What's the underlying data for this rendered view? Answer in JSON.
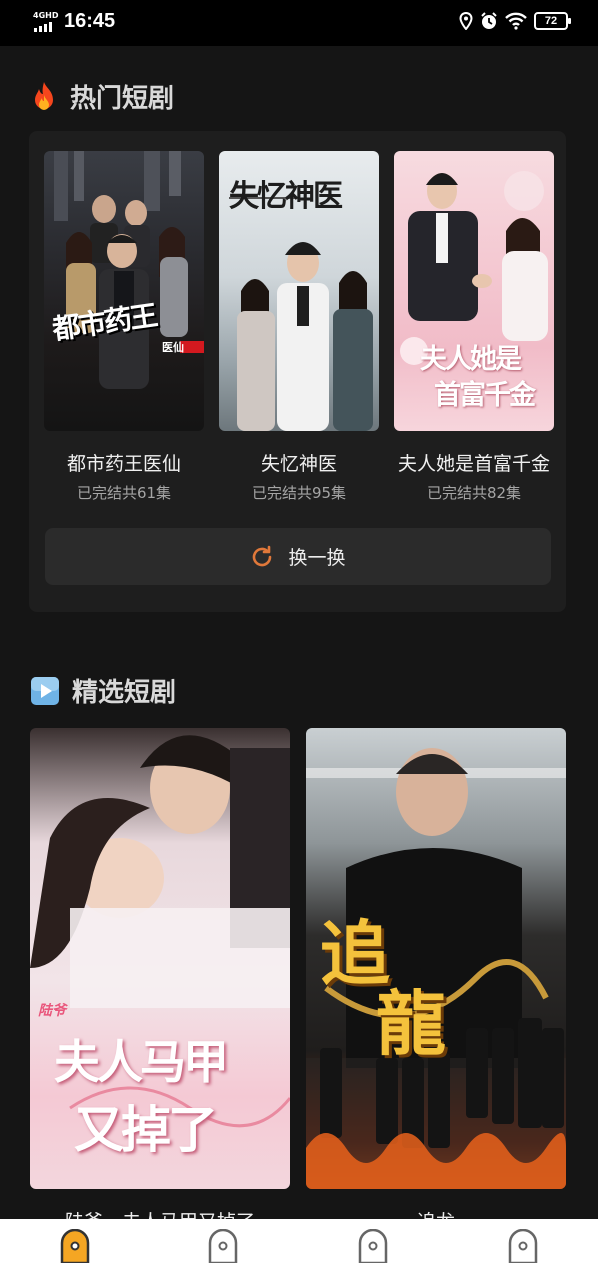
{
  "status_bar": {
    "network": "4GHD",
    "time": "16:45",
    "battery": "72",
    "icons": [
      "location-icon",
      "alarm-icon",
      "wifi-icon",
      "battery-icon"
    ]
  },
  "hot_section": {
    "icon": "fire-icon",
    "title": "热门短剧",
    "cards": [
      {
        "title": "都市药王医仙",
        "meta": "已完结共61集",
        "cover_text": "都市药王",
        "cover_tag": "医仙"
      },
      {
        "title": "失忆神医",
        "meta": "已完结共95集",
        "cover_text": "失忆神医"
      },
      {
        "title": "夫人她是首富千金",
        "meta": "已完结共82集",
        "cover_text_1": "夫人她是",
        "cover_text_2": "首富千金"
      }
    ],
    "refresh_label": "换一换",
    "refresh_icon": "refresh-icon"
  },
  "featured_section": {
    "icon": "play-icon",
    "title": "精选短剧",
    "cards": [
      {
        "title": "陆爷，夫人马甲又掉了",
        "cover_text_1": "夫人马甲",
        "cover_text_2": "又掉了",
        "cover_tag": "陆爷"
      },
      {
        "title": "追龙",
        "cover_text_1": "追",
        "cover_text_2": "龍"
      }
    ]
  },
  "tab_bar": {
    "tabs": [
      {
        "icon": "home-tab-icon",
        "active": true
      },
      {
        "icon": "tab-icon-2",
        "active": false
      },
      {
        "icon": "tab-icon-3",
        "active": false
      },
      {
        "icon": "tab-icon-4",
        "active": false
      }
    ]
  },
  "colors": {
    "accent": "#f5a623",
    "refresh_icon": "#e0783a",
    "background": "#151515",
    "panel": "#1e1e1e"
  }
}
